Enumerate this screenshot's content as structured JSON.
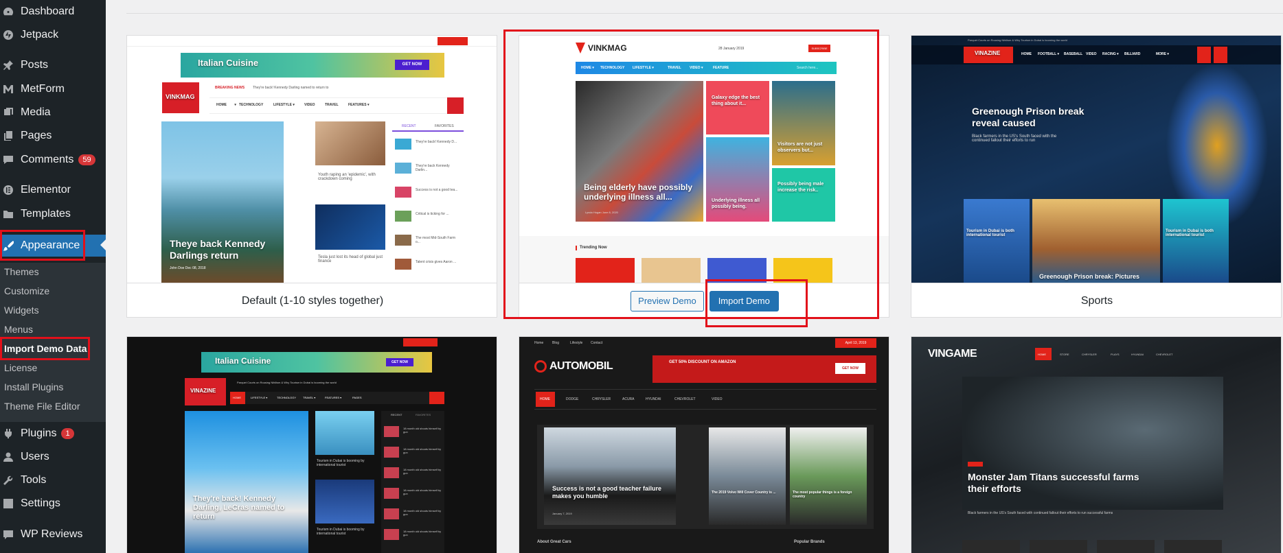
{
  "sidebar": {
    "menu": [
      {
        "label": "Dashboard"
      },
      {
        "label": "Jetpack"
      },
      {
        "label": "Posts"
      },
      {
        "label": "MetForm"
      },
      {
        "label": "Media"
      },
      {
        "label": "Pages"
      },
      {
        "label": "Comments",
        "badge": "59"
      },
      {
        "label": "Elementor"
      },
      {
        "label": "Templates"
      },
      {
        "label": "Appearance"
      },
      {
        "label": "Plugins",
        "badge": "1"
      },
      {
        "label": "Users"
      },
      {
        "label": "Tools"
      },
      {
        "label": "Settings"
      },
      {
        "label": "WP Reviews"
      }
    ],
    "submenu": [
      "Themes",
      "Customize",
      "Widgets",
      "Menus",
      "Import Demo Data",
      "License",
      "Install Plugins",
      "Theme File Editor"
    ]
  },
  "demos": [
    {
      "name": "Default (1-10 styles together)",
      "shot": {
        "ad_text": "Italian Cuisine",
        "ad_btn": "GET NOW",
        "logo": "VINKMAG",
        "breaking": "BREAKING NEWS",
        "breaking_text": "They're back! Kennedy Darling named to return to",
        "nav": [
          "HOME ▾",
          "TECHNOLOGY",
          "LIFESTYLE ▾",
          "VIDEO",
          "TRAVEL",
          "FEATURES ▾"
        ],
        "hero_title": "Theye back Kennedy Darlings return",
        "hero_meta": "John Doe   Dec 08, 2018",
        "side1": "Youth raping an 'epidemic', with crackdown coming",
        "side2": "Tesla just lost its head of global just finance",
        "tabs": [
          "RECENT",
          "FAVORITES"
        ],
        "list": [
          "They're back! Kennedy D...",
          "They're back Kennedy Darlin...",
          "Success is not a good tea...",
          "Critical is ticking for ...",
          "The most Mid-South Farm o...",
          "Talent crisis gives Aaron ..."
        ]
      }
    },
    {
      "name": "",
      "buttons": {
        "preview": "Preview Demo",
        "import": "Import Demo"
      },
      "shot": {
        "logo": "VINKMAG",
        "date": "28 January 2019",
        "subscribe": "SUBSCRIBE",
        "nav": [
          "HOME ▾",
          "TECHNOLOGY",
          "LIFESTYLE ▾",
          "TRAVEL",
          "VIDEO ▾",
          "FEATURE"
        ],
        "search": "Search here...",
        "hero_title": "Being elderly have possibly underlying illness all...",
        "hero_meta": "Lynda Hogan   June 8, 2020",
        "c1": "Galaxy edge the best thing about it...",
        "c2": "Visitors are not just observers but...",
        "c3": "Underlying illness all possibly being.",
        "c4": "Possibly being male increase the risk..",
        "trending": "Trending Now"
      }
    },
    {
      "name": "Sports",
      "shot": {
        "top": "Parquet Courts on Rousing Nihilism & Why Tourism in Dubai is booming the world",
        "logo": "VINAZINE",
        "nav": [
          "HOME",
          "FOOTBALL ▾",
          "BASEBALL",
          "VIDEO",
          "RACING ▾",
          "BILLIARD",
          "MORE ▾"
        ],
        "hero_title": "Greenough Prison break reveal caused",
        "hero_sub": "Black farmers in the US's South faced with the continued fallout their efforts to run",
        "t1": "Tourism in Dubai is both international tourist",
        "t2": "Greenough Prison break: Pictures",
        "t3": "Tourism in Dubai is both international tourist"
      }
    },
    {
      "name": "",
      "shot": {
        "ad_text": "Italian Cuisine",
        "ad_btn": "GET NOW",
        "logo": "VINAZINE",
        "breaking_text": "Parquet Courts on Rousing Nihilism & Why Tourism in Dubai is booming the world",
        "nav": [
          "HOME",
          "LIFESTYLE ▾",
          "TECHNOLOGY",
          "TRAVEL ▾",
          "FEATURES ▾",
          "PAGES"
        ],
        "hero_title": "They're back! Kennedy Darling, LeCras named to return",
        "side1": "Tourism in Dubai is booming by international tourist",
        "side2": "Tourism in Dubai is booming by international tourist",
        "tabs": [
          "RECENT",
          "FAVORITES"
        ],
        "list": [
          "18 month old shoots himself by gun",
          "18 month old shoots himself by gun",
          "18 month old shoots himself by gun",
          "18 month old shoots himself by gun",
          "18 month old shoots himself by gun",
          "18 month old shoots himself by gun"
        ]
      }
    },
    {
      "name": "",
      "shot": {
        "top": [
          "Home",
          "Blog",
          "Lifestyle",
          "Contact"
        ],
        "date": "April 13, 2019",
        "logo": "AUTOMOBIL",
        "ad": "GET 50% DISCOUNT ON AMAZON",
        "ad_btn": "GET NOW",
        "nav": [
          "HOME",
          "DODGE",
          "CHRYSLER",
          "ACURA",
          "HYUNDAI",
          "CHEVROLET",
          "VIDEO"
        ],
        "hero_title": "Success is not a good teacher failure makes you humble",
        "hero_meta": "January 7, 2019",
        "s1": "The 2019 Volvo Will Cover Country is ...",
        "s2": "The most popular things is a foreign country",
        "bottom_left": "About Great Cars",
        "bottom_right": "Popular Brands"
      }
    },
    {
      "name": "",
      "shot": {
        "logo": "VINGAME",
        "nav": [
          "HOME",
          "STORE",
          "CHRYSLER",
          "PLAYS",
          "HYUNDAI",
          "CHEVROLET"
        ],
        "hero_title": "Monster Jam Titans successful farms their efforts",
        "hero_sub": "Black farmers in the US's South faced with continued fallout their efforts to run successful farms"
      }
    }
  ]
}
